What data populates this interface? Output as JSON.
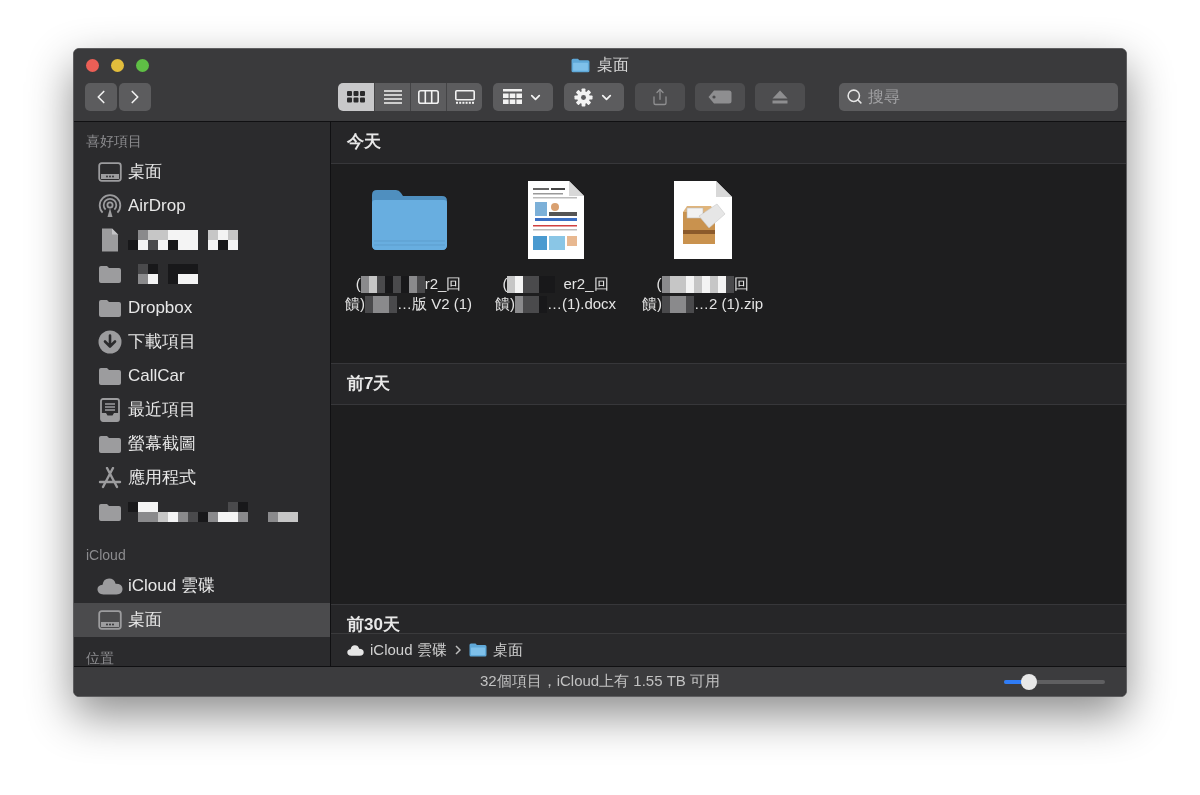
{
  "window": {
    "title": "桌面"
  },
  "toolbar": {
    "view_modes": [
      {
        "kind": "icons",
        "selected": true
      },
      {
        "kind": "list",
        "selected": false
      },
      {
        "kind": "columns",
        "selected": false
      },
      {
        "kind": "gallery",
        "selected": false
      }
    ],
    "buttons": [
      {
        "kind": "group",
        "disabled": false
      },
      {
        "kind": "action",
        "disabled": false
      },
      {
        "kind": "share",
        "disabled": true
      },
      {
        "kind": "tags",
        "disabled": true
      },
      {
        "kind": "eject",
        "disabled": true
      }
    ],
    "search": {
      "placeholder": "搜尋"
    }
  },
  "sidebar": {
    "sections": [
      {
        "title": "喜好項目",
        "items": [
          {
            "kind": "desktop",
            "label": "桌面",
            "redacted": false,
            "selected": false
          },
          {
            "kind": "airdrop",
            "label": "AirDrop",
            "redacted": false,
            "selected": false
          },
          {
            "kind": "document",
            "redacted": true,
            "selected": false
          },
          {
            "kind": "folder",
            "redacted": true,
            "selected": false
          },
          {
            "kind": "folder",
            "label": "Dropbox",
            "redacted": false,
            "selected": false
          },
          {
            "kind": "download",
            "label": "下載項目",
            "redacted": false,
            "selected": false
          },
          {
            "kind": "folder",
            "label": "CallCar",
            "redacted": false,
            "selected": false
          },
          {
            "kind": "recent",
            "label": "最近項目",
            "redacted": false,
            "selected": false
          },
          {
            "kind": "folder",
            "label": "螢幕截圖",
            "redacted": false,
            "selected": false
          },
          {
            "kind": "apps",
            "label": "應用程式",
            "redacted": false,
            "selected": false
          },
          {
            "kind": "folder",
            "redacted": true,
            "selected": false
          }
        ]
      },
      {
        "title": "iCloud",
        "items": [
          {
            "kind": "cloud",
            "label": "iCloud 雲碟",
            "redacted": false,
            "selected": false
          },
          {
            "kind": "desktop",
            "label": "桌面",
            "redacted": false,
            "selected": true
          }
        ]
      },
      {
        "title": "位置"
      }
    ]
  },
  "content": {
    "groups": [
      {
        "title": "今天",
        "files": [
          {
            "kind": "folder",
            "caption": [
              [
                {
                  "kind": "text",
                  "text": "("
                },
                {
                  "kind": "redacted"
                },
                {
                  "kind": "text",
                  "text": "r2_回"
                }
              ],
              [
                {
                  "kind": "text",
                  "text": "饋)"
                },
                {
                  "kind": "redacted"
                },
                {
                  "kind": "text",
                  "text": "…版 V2 (1)"
                }
              ]
            ]
          },
          {
            "kind": "document",
            "caption": [
              [
                {
                  "kind": "text",
                  "text": "("
                },
                {
                  "kind": "redacted"
                },
                {
                  "kind": "text",
                  "text": "er2_回"
                }
              ],
              [
                {
                  "kind": "text",
                  "text": "饋)"
                },
                {
                  "kind": "redacted"
                },
                {
                  "kind": "text",
                  "text": "…(1).docx"
                }
              ]
            ]
          },
          {
            "kind": "archive",
            "caption": [
              [
                {
                  "kind": "text",
                  "text": "("
                },
                {
                  "kind": "redacted"
                },
                {
                  "kind": "text",
                  "text": "回"
                }
              ],
              [
                {
                  "kind": "text",
                  "text": "饋)"
                },
                {
                  "kind": "redacted"
                },
                {
                  "kind": "text",
                  "text": "…2 (1).zip"
                }
              ]
            ]
          }
        ]
      },
      {
        "title": "前7天"
      },
      {
        "title": "前30天"
      }
    ]
  },
  "path_bar": [
    {
      "kind": "cloud",
      "label": "iCloud 雲碟"
    },
    {
      "kind": "folder",
      "label": "桌面"
    }
  ],
  "status_bar": {
    "text": "32個項目，iCloud上有 1.55 TB 可用",
    "zoom_slider": {
      "level": 0.25
    }
  }
}
